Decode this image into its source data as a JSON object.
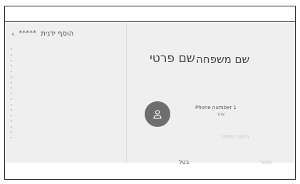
{
  "header": {
    "back_title": "הוסף ידנית",
    "masked_name": "*****"
  },
  "contact": {
    "last_name": "שם משפחה",
    "first_name": "שם פרטי",
    "phone_label": "Phone number 1",
    "phone_type": "אחר",
    "add_number": "הוסף מספר"
  },
  "actions": {
    "cancel_label": "בטל",
    "save_label": "שמור"
  },
  "icons": {
    "back": "chevron-left-icon",
    "avatar": "person-icon"
  },
  "colors": {
    "avatar_bg": "#6e6e6e",
    "screen_bg": "#efefef"
  }
}
